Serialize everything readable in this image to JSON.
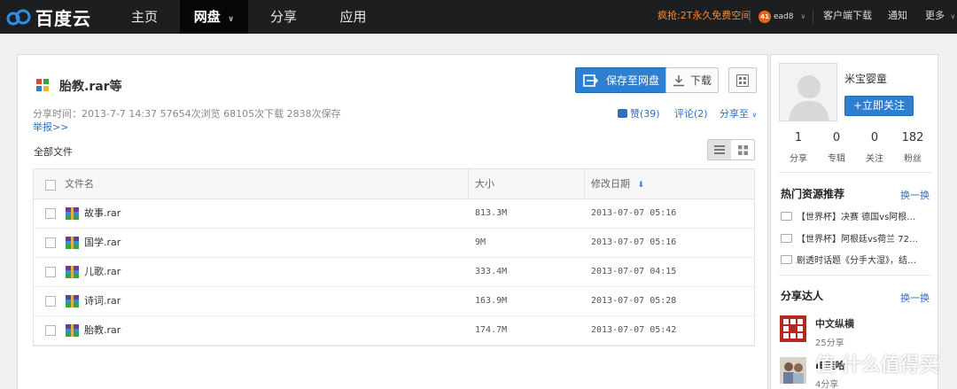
{
  "brand": {
    "name": "百度云"
  },
  "nav": [
    {
      "label": "主页",
      "active": false
    },
    {
      "label": "网盘",
      "active": true
    },
    {
      "label": "分享",
      "active": false
    },
    {
      "label": "应用",
      "active": false
    }
  ],
  "topbar": {
    "promo": "疯抢:2T永久免费空间",
    "badge": "41",
    "user": "ead8",
    "client_download": "客户端下载",
    "notifications": "通知",
    "more": "更多"
  },
  "share": {
    "title": "胎教.rar等",
    "save_button": "保存至网盘",
    "download_button": "下载",
    "meta": "分享时间：2013-7-7 14:37 57654次浏览 68105次下载 2838次保存",
    "report": "举报>>",
    "like": "赞(39)",
    "comment": "评论(2)",
    "share_to": "分享至",
    "all_files": "全部文件"
  },
  "table": {
    "col_name": "文件名",
    "col_size": "大小",
    "col_date": "修改日期",
    "rows": [
      {
        "name": "故事.rar",
        "size": "813.3M",
        "date": "2013-07-07 05:16"
      },
      {
        "name": "国学.rar",
        "size": "9M",
        "date": "2013-07-07 05:16"
      },
      {
        "name": "儿歌.rar",
        "size": "333.4M",
        "date": "2013-07-07 04:15"
      },
      {
        "name": "诗词.rar",
        "size": "163.9M",
        "date": "2013-07-07 05:28"
      },
      {
        "name": "胎教.rar",
        "size": "174.7M",
        "date": "2013-07-07 05:42"
      }
    ]
  },
  "sidebar": {
    "username": "米宝婴童",
    "follow_button": "+立即关注",
    "stats": [
      {
        "num": "1",
        "label": "分享"
      },
      {
        "num": "0",
        "label": "专辑"
      },
      {
        "num": "0",
        "label": "关注"
      },
      {
        "num": "182",
        "label": "粉丝"
      }
    ],
    "hot_title": "热门资源推荐",
    "refresh": "换一换",
    "hot_items": [
      "【世界杯】决赛 德国vs阿根…",
      "【世界杯】阿根廷vs荷兰 72…",
      "剧透时话题《分手大湿》，结…"
    ],
    "sharers_title": "分享达人",
    "sharers": [
      {
        "name": "中文纵横",
        "count": "25分享"
      },
      {
        "name": "IE哇哈",
        "count": "4分享"
      }
    ]
  },
  "watermark": "值 什么值得买"
}
